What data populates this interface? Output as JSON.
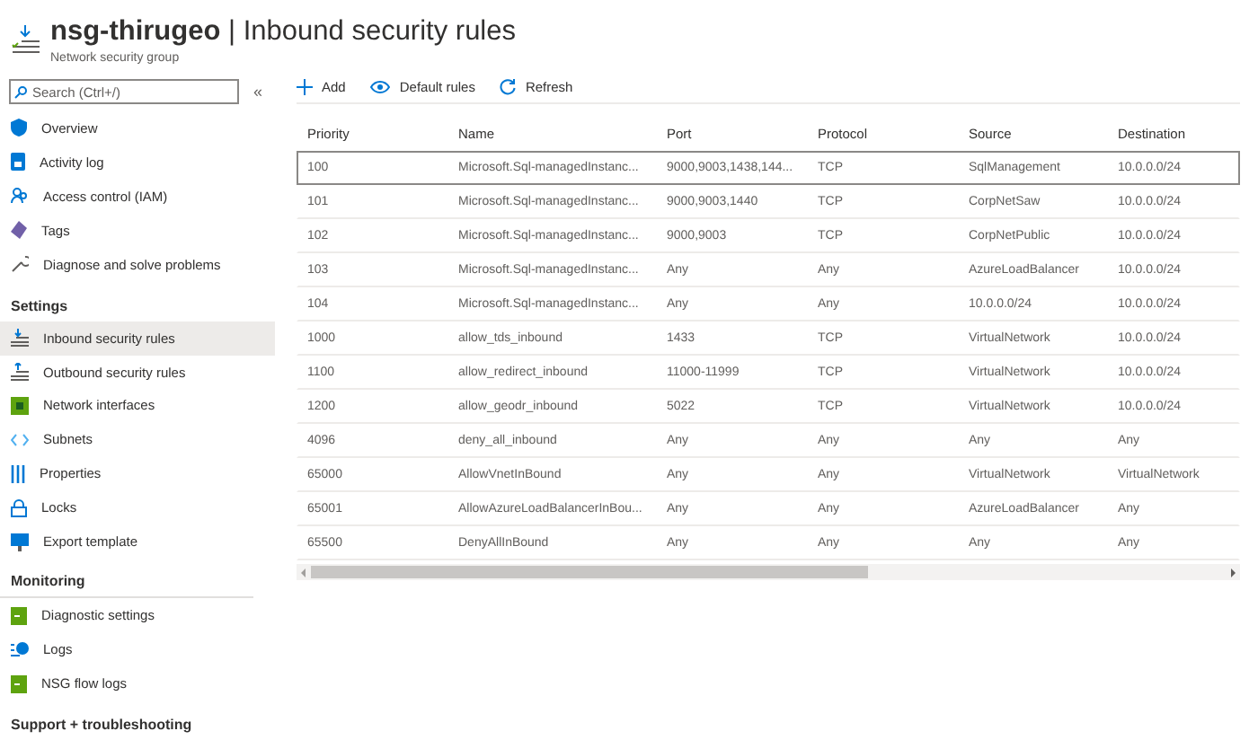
{
  "header": {
    "title": "**nsg-thirugeo** | Inbound security rules",
    "subtitle": "Network security group"
  },
  "sidebar": {
    "search": {
      "placeholder": "Search (Ctrl+/)"
    },
    "collapse": "«",
    "groups": [
      {
        "items": [
          {
            "label": "Overview",
            "selected": false
          },
          {
            "label": "Activity log",
            "selected": false
          },
          {
            "label": "Access control (IAM)",
            "selected": false
          },
          {
            "label": "Tags",
            "selected": false
          },
          {
            "label": "Diagnose and solve problems",
            "selected": false
          }
        ]
      },
      {
        "heading": "Settings",
        "items": [
          {
            "label": "Inbound security rules",
            "selected": true
          },
          {
            "label": "Outbound security rules",
            "selected": false
          },
          {
            "label": "Network interfaces",
            "selected": false
          },
          {
            "label": "Subnets",
            "selected": false
          },
          {
            "label": "Properties",
            "selected": false
          },
          {
            "label": "Locks",
            "selected": false
          },
          {
            "label": "Export template",
            "selected": false
          }
        ]
      },
      {
        "heading": "Monitoring",
        "items": [
          {
            "label": "Diagnostic settings",
            "selected": false
          },
          {
            "label": "Logs",
            "selected": false
          },
          {
            "label": "NSG flow logs",
            "selected": false
          }
        ]
      },
      {
        "heading": "Support + troubleshooting"
      }
    ]
  },
  "toolbar": [
    "Add",
    "Default rules",
    "Refresh"
  ],
  "table": {
    "columns": [
      "Priority",
      "Name",
      "Port",
      "Protocol",
      "Source",
      "Destination"
    ],
    "rows": [
      {
        "cells": [
          "100",
          "Microsoft.Sql-managedInstanc...",
          "9000,9003,1438,144...",
          "TCP",
          "SqlManagement",
          "10.0.0.0/24"
        ],
        "selected": true
      },
      {
        "cells": [
          "101",
          "Microsoft.Sql-managedInstanc...",
          "9000,9003,1440",
          "TCP",
          "CorpNetSaw",
          "10.0.0.0/24"
        ],
        "selected": false
      },
      {
        "cells": [
          "102",
          "Microsoft.Sql-managedInstanc...",
          "9000,9003",
          "TCP",
          "CorpNetPublic",
          "10.0.0.0/24"
        ],
        "selected": false
      },
      {
        "cells": [
          "103",
          "Microsoft.Sql-managedInstanc...",
          "Any",
          "Any",
          "AzureLoadBalancer",
          "10.0.0.0/24"
        ],
        "selected": false
      },
      {
        "cells": [
          "104",
          "Microsoft.Sql-managedInstanc...",
          "Any",
          "Any",
          "10.0.0.0/24",
          "10.0.0.0/24"
        ],
        "selected": false
      },
      {
        "cells": [
          "1000",
          "allow_tds_inbound",
          "1433",
          "TCP",
          "VirtualNetwork",
          "10.0.0.0/24"
        ],
        "selected": false
      },
      {
        "cells": [
          "1100",
          "allow_redirect_inbound",
          "11000-11999",
          "TCP",
          "VirtualNetwork",
          "10.0.0.0/24"
        ],
        "selected": false
      },
      {
        "cells": [
          "1200",
          "allow_geodr_inbound",
          "5022",
          "TCP",
          "VirtualNetwork",
          "10.0.0.0/24"
        ],
        "selected": false
      },
      {
        "cells": [
          "4096",
          "deny_all_inbound",
          "Any",
          "Any",
          "Any",
          "Any"
        ],
        "selected": false
      },
      {
        "cells": [
          "65000",
          "AllowVnetInBound",
          "Any",
          "Any",
          "VirtualNetwork",
          "VirtualNetwork"
        ],
        "selected": false
      },
      {
        "cells": [
          "65001",
          "AllowAzureLoadBalancerInBou...",
          "Any",
          "Any",
          "AzureLoadBalancer",
          "Any"
        ],
        "selected": false
      },
      {
        "cells": [
          "65500",
          "DenyAllInBound",
          "Any",
          "Any",
          "Any",
          "Any"
        ],
        "selected": false
      }
    ]
  }
}
